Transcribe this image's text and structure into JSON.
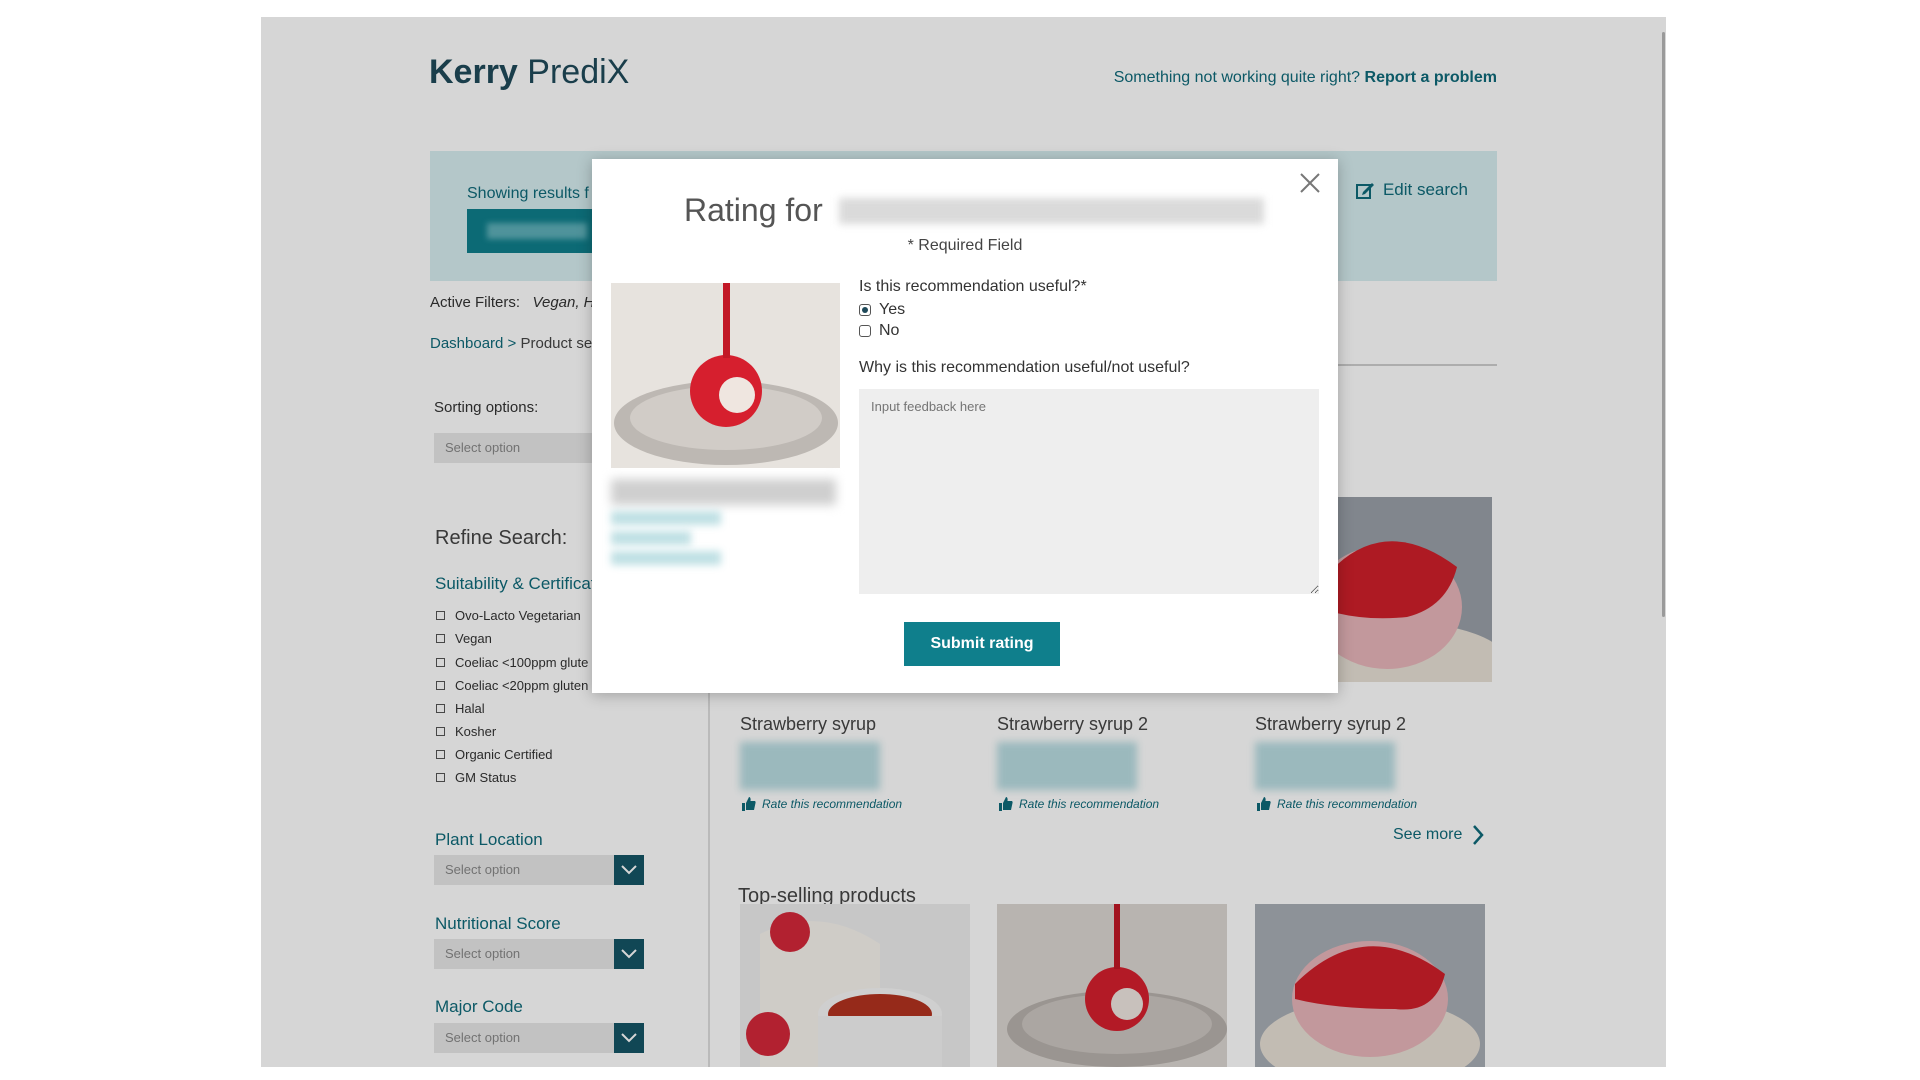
{
  "header": {
    "logo_bold": "Kerry",
    "logo_light": "PrediX",
    "report_text": "Something not working quite right?",
    "report_link": "Report a problem"
  },
  "results_bar": {
    "showing_text": "Showing results f",
    "edit_search": "Edit search"
  },
  "filters": {
    "active_label": "Active Filters:",
    "active_values": "Vegan, H"
  },
  "breadcrumb": {
    "dashboard": "Dashboard >",
    "current": "Product se"
  },
  "sidebar": {
    "sorting_label": "Sorting options:",
    "sorting_placeholder": "Select option",
    "refine_title": "Refine Search:",
    "suitability_title": "Suitability & Certificat",
    "suitability_items": [
      "Ovo-Lacto Vegetarian",
      "Vegan",
      "Coeliac <100ppm glute",
      "Coeliac <20ppm gluten",
      "Halal",
      "Kosher",
      "Organic Certified",
      "GM Status"
    ],
    "plant_location": "Plant Location",
    "plant_placeholder": "Select option",
    "nutritional_score": "Nutritional Score",
    "nutritional_placeholder": "Select option",
    "major_code": "Major Code",
    "major_placeholder": "Select option"
  },
  "recommendations": {
    "cards": [
      {
        "name": "Strawberry syrup",
        "rate": "Rate this recommendation"
      },
      {
        "name": "Strawberry syrup 2",
        "rate": "Rate this recommendation"
      },
      {
        "name": "Strawberry syrup 2",
        "rate": "Rate this recommendation"
      }
    ],
    "see_more": "See more"
  },
  "top_selling": {
    "title": "Top-selling products"
  },
  "modal": {
    "title": "Rating for",
    "required_note": "* Required Field",
    "question1": "Is this recommendation useful?*",
    "option_yes": "Yes",
    "option_no": "No",
    "selected": "Yes",
    "question2": "Why is this recommendation useful/not useful?",
    "feedback_placeholder": "Input feedback here",
    "submit_label": "Submit rating"
  },
  "colors": {
    "brand_teal": "#0f6a7a",
    "button_teal": "#0f7f8c",
    "dark_teal": "#155566"
  },
  "icons": {
    "close": "close-icon",
    "edit": "edit-icon",
    "chevron_down": "chevron-down-icon",
    "chevron_right": "chevron-right-icon",
    "thumbs_up": "thumbs-up-icon"
  }
}
